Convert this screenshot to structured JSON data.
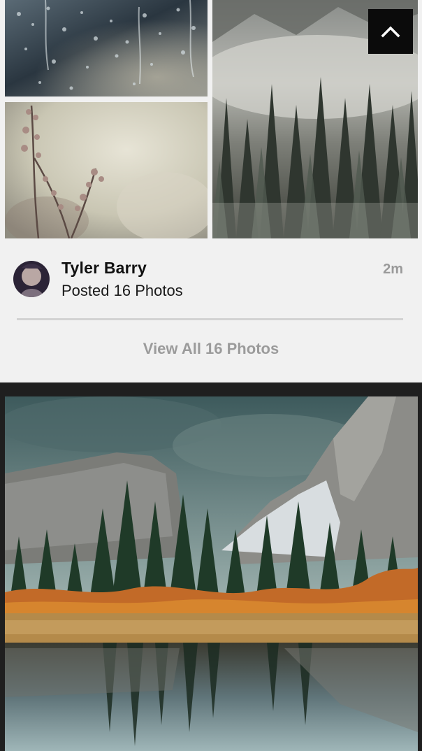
{
  "post": {
    "author": "Tyler Barry",
    "posted_text": "Posted 16 Photos",
    "time_ago": "2m",
    "view_all_label": "View All 16 Photos"
  },
  "photos": [
    {
      "subject": "raindrops on window"
    },
    {
      "subject": "dry flower stems"
    },
    {
      "subject": "misty pine forest"
    },
    {
      "subject": "mountain valley reflected in lake"
    }
  ],
  "icons": {
    "scroll_top": "chevron-up-icon"
  },
  "colors": {
    "card_background": "#f1f1f1",
    "feed_background": "#1f1f1f",
    "secondary_text": "#9a9a9a"
  }
}
